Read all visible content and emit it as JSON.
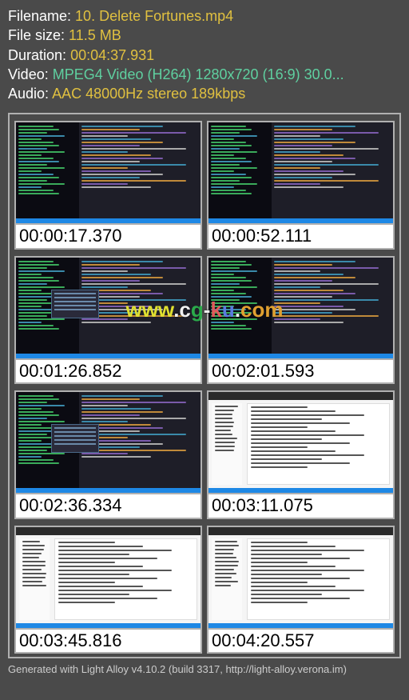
{
  "metadata": {
    "filename_label": "Filename:",
    "filename_value": "10. Delete Fortunes.mp4",
    "filesize_label": "File size:",
    "filesize_value": "11.5 MB",
    "duration_label": "Duration:",
    "duration_value": "00:04:37.931",
    "video_label": "Video:",
    "video_value": "MPEG4 Video (H264) 1280x720 (16:9) 30.0...",
    "audio_label": "Audio:",
    "audio_value": "AAC 48000Hz stereo 189kbps"
  },
  "thumbnails": [
    {
      "time": "00:00:17.370",
      "style": "dark"
    },
    {
      "time": "00:00:52.111",
      "style": "dark"
    },
    {
      "time": "00:01:26.852",
      "style": "dark_popup"
    },
    {
      "time": "00:02:01.593",
      "style": "dark"
    },
    {
      "time": "00:02:36.334",
      "style": "dark_popup"
    },
    {
      "time": "00:03:11.075",
      "style": "light"
    },
    {
      "time": "00:03:45.816",
      "style": "light"
    },
    {
      "time": "00:04:20.557",
      "style": "light"
    }
  ],
  "watermark": {
    "text": "www.cg-ku.com"
  },
  "footer": {
    "text": "Generated with Light Alloy v4.10.2 (build 3317, http://light-alloy.verona.im)"
  }
}
